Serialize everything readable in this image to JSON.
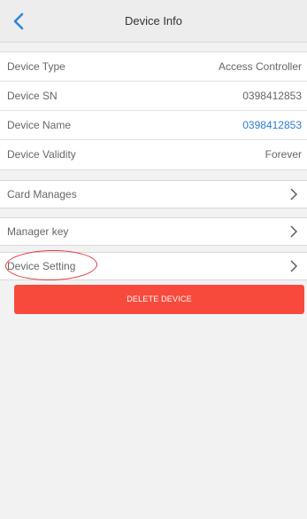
{
  "header": {
    "title": "Device Info"
  },
  "info": [
    {
      "label": "Device Type",
      "value": "Access Controller"
    },
    {
      "label": "Device SN",
      "value": "0398412853"
    },
    {
      "label": "Device Name",
      "value": "0398412853"
    },
    {
      "label": "Device Validity",
      "value": "Forever"
    }
  ],
  "menu": {
    "card_manages": "Card Manages",
    "manager_key": "Manager key",
    "device_setting": "Device Setting"
  },
  "actions": {
    "delete_label": "DELETE DEVICE"
  },
  "icons": {
    "back": "chevron-left-icon",
    "row_arrow": "chevron-right-icon"
  },
  "colors": {
    "accent_blue": "#2d7dd2",
    "delete_red": "#f74a3c",
    "highlight_red": "#e0383e"
  }
}
